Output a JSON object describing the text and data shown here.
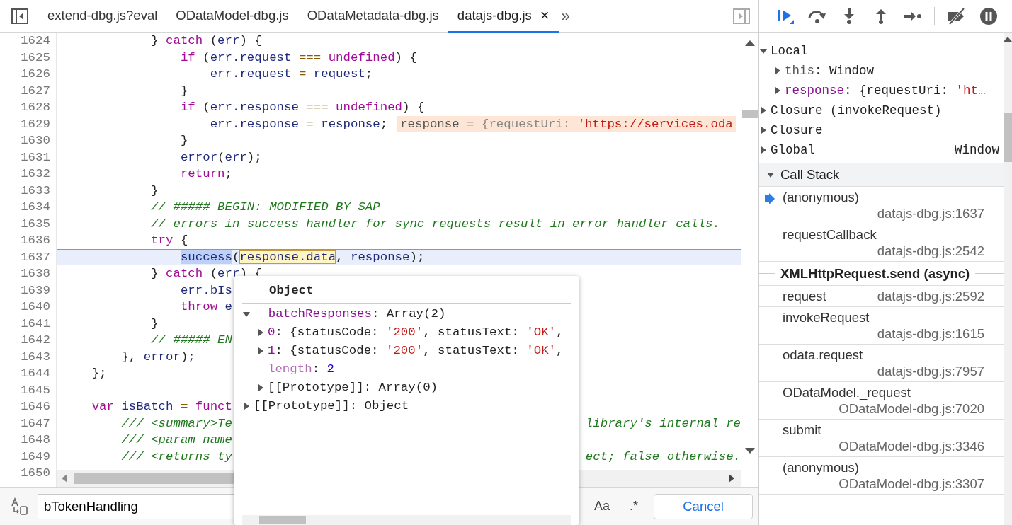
{
  "tabs": [
    {
      "label": "extend-dbg.js?eval",
      "selected": false
    },
    {
      "label": "ODataModel-dbg.js",
      "selected": false
    },
    {
      "label": "ODataMetadata-dbg.js",
      "selected": false
    },
    {
      "label": "datajs-dbg.js",
      "selected": true,
      "close": "×"
    }
  ],
  "tabs_overflow": "»",
  "code": {
    "lines": [
      {
        "number": "1624",
        "current": false,
        "tokens": [
          {
            "kind": "plain",
            "text": "            } "
          },
          {
            "kind": "kw",
            "text": "catch"
          },
          {
            "kind": "plain",
            "text": " ("
          },
          {
            "kind": "var",
            "text": "err"
          },
          {
            "kind": "plain",
            "text": ") {"
          }
        ]
      },
      {
        "number": "1625",
        "current": false,
        "tokens": [
          {
            "kind": "kw",
            "text": "                if"
          },
          {
            "kind": "plain",
            "text": " ("
          },
          {
            "kind": "var",
            "text": "err.request"
          },
          {
            "kind": "op",
            "text": " === "
          },
          {
            "kind": "atom",
            "text": "undefined"
          },
          {
            "kind": "plain",
            "text": ") {"
          }
        ]
      },
      {
        "number": "1626",
        "current": false,
        "tokens": [
          {
            "kind": "var",
            "text": "                    err.request"
          },
          {
            "kind": "op",
            "text": " = "
          },
          {
            "kind": "var",
            "text": "request"
          },
          {
            "kind": "plain",
            "text": ";"
          }
        ]
      },
      {
        "number": "1627",
        "current": false,
        "tokens": [
          {
            "kind": "plain",
            "text": "                }"
          }
        ]
      },
      {
        "number": "1628",
        "current": false,
        "tokens": [
          {
            "kind": "kw",
            "text": "                if"
          },
          {
            "kind": "plain",
            "text": " ("
          },
          {
            "kind": "var",
            "text": "err.response"
          },
          {
            "kind": "op",
            "text": " === "
          },
          {
            "kind": "atom",
            "text": "undefined"
          },
          {
            "kind": "plain",
            "text": ") {"
          }
        ]
      },
      {
        "number": "1629",
        "current": false,
        "tokens": [
          {
            "kind": "var",
            "text": "                    err.response"
          },
          {
            "kind": "op",
            "text": " = "
          },
          {
            "kind": "var",
            "text": "response"
          },
          {
            "kind": "plain",
            "text": ";"
          }
        ],
        "inline_value": [
          {
            "kind": "muted",
            "text": "response = "
          },
          {
            "kind": "faint",
            "text": "{requestUri: "
          },
          {
            "kind": "string",
            "text": "'https://services.oda"
          }
        ]
      },
      {
        "number": "1630",
        "current": false,
        "tokens": [
          {
            "kind": "plain",
            "text": "                }"
          }
        ]
      },
      {
        "number": "1631",
        "current": false,
        "tokens": [
          {
            "kind": "var",
            "text": "                error"
          },
          {
            "kind": "plain",
            "text": "("
          },
          {
            "kind": "var",
            "text": "err"
          },
          {
            "kind": "plain",
            "text": ");"
          }
        ]
      },
      {
        "number": "1632",
        "current": false,
        "tokens": [
          {
            "kind": "kw",
            "text": "                return"
          },
          {
            "kind": "plain",
            "text": ";"
          }
        ]
      },
      {
        "number": "1633",
        "current": false,
        "tokens": [
          {
            "kind": "plain",
            "text": "            }"
          }
        ]
      },
      {
        "number": "1634",
        "current": false,
        "tokens": [
          {
            "kind": "comment",
            "text": "            // ##### BEGIN: MODIFIED BY SAP"
          }
        ]
      },
      {
        "number": "1635",
        "current": false,
        "tokens": [
          {
            "kind": "comment",
            "text": "            // errors in success handler for sync requests result in error handler calls."
          }
        ]
      },
      {
        "number": "1636",
        "current": false,
        "tokens": [
          {
            "kind": "kw",
            "text": "            try"
          },
          {
            "kind": "plain",
            "text": " {"
          }
        ]
      },
      {
        "number": "1637",
        "current": true,
        "tokens": [
          {
            "kind": "var",
            "text": "                success",
            "selected": true
          },
          {
            "kind": "plain",
            "text": "("
          },
          {
            "kind": "var",
            "text": "response.data",
            "hovered": true
          },
          {
            "kind": "plain",
            "text": ", "
          },
          {
            "kind": "var",
            "text": "response"
          },
          {
            "kind": "plain",
            "text": ");"
          }
        ]
      },
      {
        "number": "1638",
        "current": false,
        "tokens": [
          {
            "kind": "plain",
            "text": "            } "
          },
          {
            "kind": "kw",
            "text": "catch"
          },
          {
            "kind": "plain",
            "text": " ("
          },
          {
            "kind": "var",
            "text": "err"
          },
          {
            "kind": "plain",
            "text": ") {"
          }
        ]
      },
      {
        "number": "1639",
        "current": false,
        "tokens": [
          {
            "kind": "var",
            "text": "                err.bIs"
          }
        ]
      },
      {
        "number": "1640",
        "current": false,
        "tokens": [
          {
            "kind": "kw",
            "text": "                throw"
          },
          {
            "kind": "var",
            "text": " e"
          }
        ]
      },
      {
        "number": "1641",
        "current": false,
        "tokens": [
          {
            "kind": "plain",
            "text": "            }"
          }
        ]
      },
      {
        "number": "1642",
        "current": false,
        "tokens": [
          {
            "kind": "comment",
            "text": "            // ##### EN"
          }
        ]
      },
      {
        "number": "1643",
        "current": false,
        "tokens": [
          {
            "kind": "plain",
            "text": "        }, "
          },
          {
            "kind": "var",
            "text": "error"
          },
          {
            "kind": "plain",
            "text": ");"
          }
        ]
      },
      {
        "number": "1644",
        "current": false,
        "tokens": [
          {
            "kind": "plain",
            "text": "    };"
          }
        ]
      },
      {
        "number": "1645",
        "current": false
      },
      {
        "number": "1646",
        "current": false,
        "tokens": [
          {
            "kind": "kw",
            "text": "    var"
          },
          {
            "kind": "var",
            "text": " isBatch"
          },
          {
            "kind": "op",
            "text": " = "
          },
          {
            "kind": "kw",
            "text": "funct"
          }
        ]
      },
      {
        "number": "1647",
        "current": false,
        "tokens": [
          {
            "kind": "comment",
            "text": "        /// <summary>Te"
          }
        ],
        "tail": [
          {
            "kind": "comment",
            "text": "library's internal re"
          }
        ]
      },
      {
        "number": "1648",
        "current": false,
        "tokens": [
          {
            "kind": "comment",
            "text": "        /// <param name"
          }
        ]
      },
      {
        "number": "1649",
        "current": false,
        "tokens": [
          {
            "kind": "comment",
            "text": "        /// <returns ty"
          }
        ],
        "tail": [
          {
            "kind": "comment",
            "text": "ect; false otherwise."
          }
        ]
      },
      {
        "number": "1650",
        "current": false
      }
    ]
  },
  "popup": {
    "title": "Object",
    "rows": [
      {
        "expanded": true,
        "segments": [
          {
            "kind": "key",
            "text": "__batchResponses"
          },
          {
            "kind": "plain",
            "text": ": Array(2)"
          }
        ],
        "children": [
          {
            "expanded": false,
            "segments": [
              {
                "kind": "key",
                "text": "0"
              },
              {
                "kind": "plain",
                "text": ": {statusCode: "
              },
              {
                "kind": "string",
                "text": "'200'"
              },
              {
                "kind": "plain",
                "text": ", statusText: "
              },
              {
                "kind": "string",
                "text": "'OK'"
              },
              {
                "kind": "plain",
                "text": ","
              }
            ]
          },
          {
            "expanded": false,
            "segments": [
              {
                "kind": "key",
                "text": "1"
              },
              {
                "kind": "plain",
                "text": ": {statusCode: "
              },
              {
                "kind": "string",
                "text": "'200'"
              },
              {
                "kind": "plain",
                "text": ", statusText: "
              },
              {
                "kind": "string",
                "text": "'OK'"
              },
              {
                "kind": "plain",
                "text": ","
              }
            ]
          },
          {
            "segments": [
              {
                "kind": "keydim",
                "text": "length"
              },
              {
                "kind": "plain",
                "text": ": "
              },
              {
                "kind": "number",
                "text": "2"
              }
            ]
          },
          {
            "expanded": false,
            "segments": [
              {
                "kind": "plain",
                "text": "[[Prototype]]: Array(0)"
              }
            ]
          }
        ]
      },
      {
        "expanded": false,
        "segments": [
          {
            "kind": "plain",
            "text": "[[Prototype]]: Object"
          }
        ]
      }
    ]
  },
  "search": {
    "value": "bTokenHandling",
    "toggles": [
      {
        "label": "Aa",
        "on": false
      },
      {
        "label": ".*",
        "on": false
      }
    ],
    "cancel": "Cancel"
  },
  "scope": [
    {
      "expanded": true,
      "segments": [
        {
          "kind": "plain",
          "text": "Local"
        }
      ],
      "children": [
        {
          "expanded": false,
          "segments": [
            {
              "kind": "muted",
              "text": "this"
            },
            {
              "kind": "plain",
              "text": ": Window"
            }
          ]
        },
        {
          "expanded": false,
          "segments": [
            {
              "kind": "key",
              "text": "response"
            },
            {
              "kind": "plain",
              "text": ": {requestUri: "
            },
            {
              "kind": "string",
              "text": "'ht…"
            }
          ]
        }
      ]
    },
    {
      "expanded": false,
      "segments": [
        {
          "kind": "plain",
          "text": "Closure (invokeRequest)"
        }
      ]
    },
    {
      "expanded": false,
      "segments": [
        {
          "kind": "plain",
          "text": "Closure"
        }
      ]
    },
    {
      "expanded": false,
      "segments": [
        {
          "kind": "plain",
          "text": "Global"
        }
      ],
      "value": "Window"
    }
  ],
  "call_stack": {
    "title": "Call Stack",
    "expanded": true,
    "frames": [
      {
        "kind": "frame",
        "function": "(anonymous)",
        "location": "datajs-dbg.js:1637",
        "selected": true
      },
      {
        "kind": "frame",
        "function": "requestCallback",
        "location": "datajs-dbg.js:2542",
        "selected": false
      },
      {
        "kind": "async",
        "function": "XMLHttpRequest.send (async)"
      },
      {
        "kind": "frame",
        "function": "request",
        "location": "datajs-dbg.js:2592",
        "selected": false
      },
      {
        "kind": "frame",
        "function": "invokeRequest",
        "location": "datajs-dbg.js:1615",
        "selected": false
      },
      {
        "kind": "frame",
        "function": "odata.request",
        "location": "datajs-dbg.js:7957",
        "selected": false
      },
      {
        "kind": "frame",
        "function": "ODataModel._request",
        "location": "ODataModel-dbg.js:7020",
        "selected": false
      },
      {
        "kind": "frame",
        "function": "submit",
        "location": "ODataModel-dbg.js:3346",
        "selected": false
      },
      {
        "kind": "frame",
        "function": "(anonymous)",
        "location": "ODataModel-dbg.js:3307",
        "selected": false
      }
    ]
  }
}
